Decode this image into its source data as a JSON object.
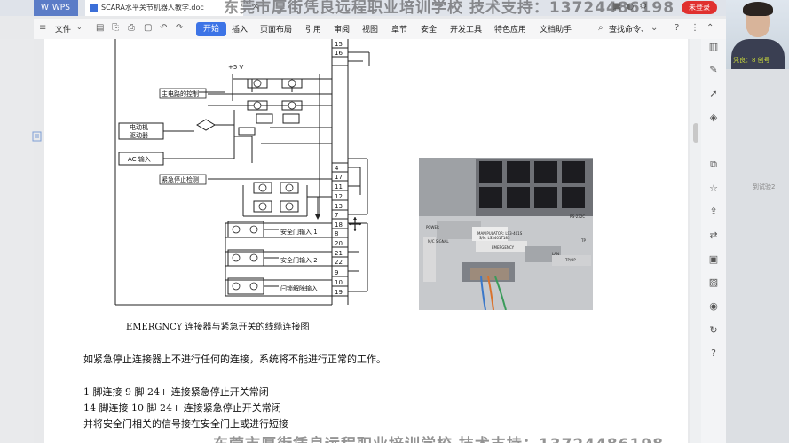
{
  "titlebar": {
    "app_tab": "WPS",
    "doc_tab": "SCARA水平关节机器人教学.doc",
    "close_glyph": "×",
    "login_button": "未登录"
  },
  "watermark": {
    "top": "东莞市厚街凭良远程职业培训学校 技术支持：13724486198",
    "bottom": "东莞市厚街凭良远程职业培训学校 技术支持：13724486198"
  },
  "menubar": {
    "file": "文件",
    "start": "开始",
    "items": [
      "插入",
      "页面布局",
      "引用",
      "审阅",
      "视图",
      "章节",
      "安全",
      "开发工具",
      "特色应用",
      "文档助手"
    ],
    "search": "查找命令、"
  },
  "diagram": {
    "labels": {
      "plus5v": "+5 V",
      "main_circuit": "主电路的控制",
      "motor_driver_1": "电动机",
      "motor_driver_2": "驱动器",
      "ac_input": "AC 输入",
      "estop_detect": "紧急停止检测",
      "door_input_1": "安全门输入 1",
      "door_input_2": "安全门输入 2",
      "latch_release": "闩锁解除输入"
    },
    "pins_top": [
      "15",
      "16"
    ],
    "pins_mid": [
      "4",
      "17",
      "11",
      "12",
      "13"
    ],
    "pins_low": [
      "7",
      "18",
      "20",
      "21",
      "22",
      "9",
      "10"
    ],
    "pins_bottom": [
      "8",
      "19"
    ]
  },
  "photo_labels": {
    "manip": "MANIPULATOR: LS3-401S",
    "sn": "S/N: LS3401T183",
    "emergency": "EMERGENCY",
    "tp": "TP",
    "power": "POWER",
    "m_c_signal": "M/C SIGNAL",
    "rs232": "RS-232C",
    "tp_op": "TP/OP",
    "lan": "LAN"
  },
  "document": {
    "caption": "EMERGNCY 连接器与紧急开关的线缆连接图",
    "para1": "如紧急停止连接器上不进行任何的连接，系统将不能进行正常的工作。",
    "line1": "1 脚连接 9 脚 24+  连接紧急停止开关常闭",
    "line2": "14 脚连接 10 脚 24+  连接紧急停止开关常闭",
    "line3": "并将安全门相关的信号接在安全门上或进行短接"
  },
  "webcam": {
    "caption": "凭良：8 创号"
  },
  "misc": {
    "side_text": "到试验2"
  }
}
